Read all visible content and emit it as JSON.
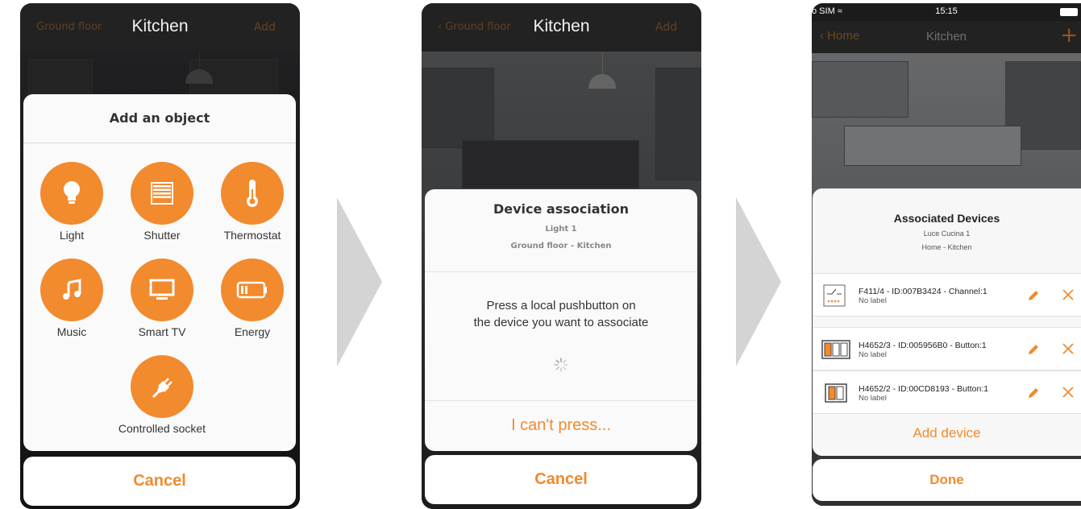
{
  "screen1": {
    "nav": {
      "left": "Ground floor",
      "title": "Kitchen",
      "right": "Add"
    },
    "sheet_title": "Add an object",
    "objects": [
      {
        "label": "Light",
        "icon": "bulb-icon"
      },
      {
        "label": "Shutter",
        "icon": "shutter-icon"
      },
      {
        "label": "Thermostat",
        "icon": "thermometer-icon"
      },
      {
        "label": "Music",
        "icon": "music-note-icon"
      },
      {
        "label": "Smart TV",
        "icon": "tv-icon"
      },
      {
        "label": "Energy",
        "icon": "battery-icon"
      },
      {
        "label": "Controlled socket",
        "icon": "plug-icon"
      }
    ],
    "cancel": "Cancel"
  },
  "screen2": {
    "nav": {
      "left": "Ground floor",
      "title": "Kitchen",
      "right": "Add"
    },
    "title": "Device association",
    "device": "Light 1",
    "location": "Ground floor - Kitchen",
    "message_line1": "Press a local pushbutton on",
    "message_line2": "the device you want to associate",
    "cant_press": "I can't press...",
    "cancel": "Cancel"
  },
  "screen3": {
    "status": {
      "carrier": "o SIM",
      "time": "15:15"
    },
    "nav": {
      "back": "Home",
      "title": "Kitchen",
      "add": "+"
    },
    "title": "Associated Devices",
    "device_name": "Luce Cucina 1",
    "location": "Home - Kitchen",
    "devices": [
      {
        "name": "F411/4 - ID:007B3424 - Channel:1",
        "label": "No label"
      },
      {
        "name": "H4652/3 - ID:005956B0 - Button:1",
        "label": "No label"
      },
      {
        "name": "H4652/2 - ID:00CD8193 - Button:1",
        "label": "No label"
      }
    ],
    "add_device": "Add device",
    "done": "Done"
  },
  "colors": {
    "accent": "#f28a2e",
    "sheet": "#fafafa",
    "nav": "#222222",
    "arrow": "#d4d4d4"
  }
}
